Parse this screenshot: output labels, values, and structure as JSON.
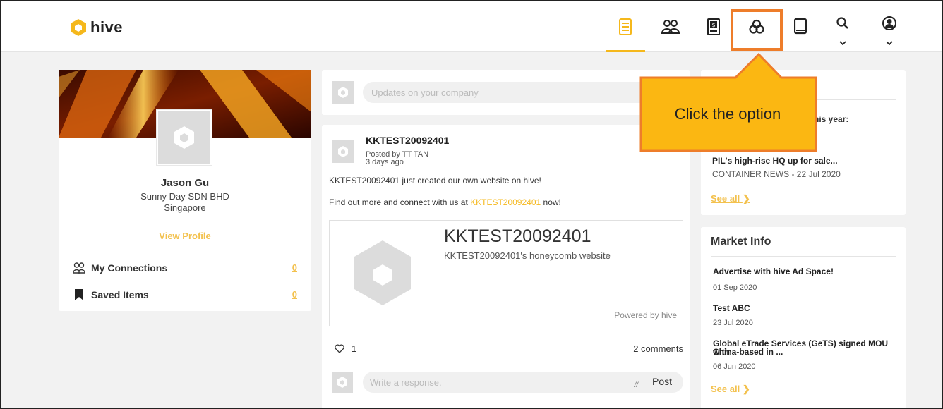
{
  "brand": {
    "name": "hive",
    "accent": "#f5b81c",
    "highlight": "#ee7d2a"
  },
  "nav": [
    {
      "name": "feed-icon",
      "active": true
    },
    {
      "name": "connections-icon"
    },
    {
      "name": "trade-icon"
    },
    {
      "name": "hive-network-icon"
    },
    {
      "name": "book-icon"
    },
    {
      "name": "search-icon",
      "caret": true
    },
    {
      "name": "profile-icon",
      "caret": true
    }
  ],
  "callout": {
    "text": "Click the option"
  },
  "profile": {
    "name": "Jason Gu",
    "company": "Sunny Day SDN BHD",
    "city": "Singapore",
    "view_profile": "View Profile",
    "connections_label": "My Connections",
    "connections_count": "0",
    "saved_label": "Saved Items",
    "saved_count": "0"
  },
  "composer": {
    "placeholder": "Updates on your company"
  },
  "post": {
    "title": "KKTEST20092401",
    "posted_by": "Posted by TT TAN",
    "ago": "3 days ago",
    "line1": "KKTEST20092401 just created our own website on hive!",
    "line2_pre": "Find out more and connect with us at ",
    "line2_link": "KKTEST20092401",
    "line2_post": " now!",
    "web_title": "KKTEST20092401",
    "web_desc": "KKTEST20092401's honeycomb website",
    "powered": "Powered by hive",
    "likes": "1",
    "comments": "2 comments",
    "response_placeholder": "Write a response.",
    "post_button": "Post"
  },
  "news": {
    "year_text": "this year:",
    "title": "PIL's high-rise HQ up for sale...",
    "source": "CONTAINER NEWS - 22 Jul 2020",
    "see_all": "See all"
  },
  "market": {
    "header": "Market Info",
    "items": [
      {
        "title": "Advertise with hive Ad Space!",
        "date": "01 Sep 2020"
      },
      {
        "title": "Test ABC",
        "date": "23 Jul 2020"
      },
      {
        "title": "Global eTrade Services (GeTS) signed MOU with",
        "title2": "China-based in ...",
        "date": "06 Jun 2020"
      }
    ],
    "see_all": "See all"
  }
}
